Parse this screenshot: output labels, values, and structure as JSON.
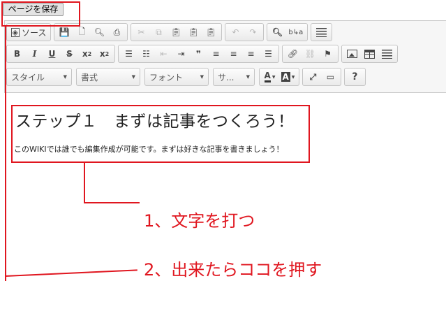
{
  "save_button": "ページを保存",
  "toolbar": {
    "source_label": "ソース",
    "combos": [
      "スタイル",
      "書式",
      "フォント",
      "サ..."
    ],
    "combo_arrow": "▼",
    "buttons": {
      "bold": "B",
      "italic": "I",
      "underline": "U",
      "strike": "S",
      "subscript_base": "x",
      "subscript_mark": "2",
      "superscript_base": "x",
      "superscript_mark": "2",
      "blockquote": "❞",
      "font_color": "A",
      "bg_color": "A",
      "help": "?"
    }
  },
  "content": {
    "heading": "ステップ１　まずは記事をつくろう！",
    "paragraph": "このWIKIでは誰でも編集作成が可能です。まずは好きな記事を書きましょう！"
  },
  "annotations": {
    "step1": "1、文字を打つ",
    "step2": "2、出来たらココを押す"
  },
  "colors": {
    "annotation": "#e0161f",
    "toolbar_bg": "#f6f6f6"
  }
}
